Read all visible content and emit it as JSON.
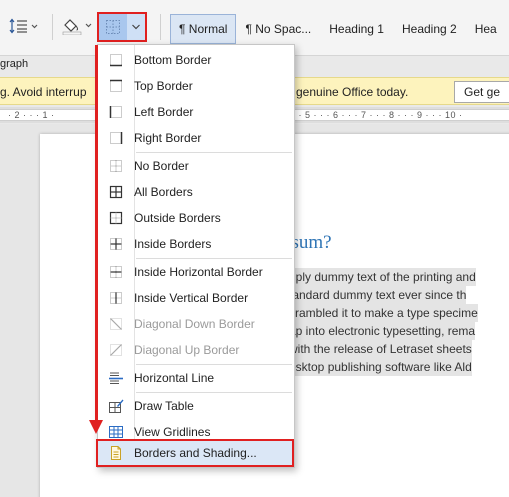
{
  "ribbon": {
    "styles": [
      {
        "label": "¶ Normal",
        "active": true
      },
      {
        "label": "¶ No Spac...",
        "active": false
      },
      {
        "label": "Heading 1",
        "active": false
      },
      {
        "label": "Heading 2",
        "active": false
      },
      {
        "label": "Hea",
        "active": false
      }
    ],
    "group_label": "graph"
  },
  "notification": {
    "left_text": "g. Avoid interrup",
    "right_text": "genuine Office today.",
    "button_label": "Get ge"
  },
  "ruler": {
    "left_marks": "· 2 · · · 1 ·",
    "right_marks": "· · 5 · · · 6 · · · 7 · · · 8 · · · 9 · · · 10 ·"
  },
  "document": {
    "heading": "psum?",
    "lines": [
      "nply dummy text of the printing and",
      "tandard dummy text ever since th",
      "crambled it to make a type specime",
      "ap into electronic typesetting, rema",
      "with the release of Letraset sheets",
      "esktop publishing software like Ald"
    ]
  },
  "borders_menu": {
    "items": [
      {
        "label": "Bottom Border",
        "icon": "bottom-border-icon",
        "disabled": false
      },
      {
        "label": "Top Border",
        "icon": "top-border-icon",
        "disabled": false
      },
      {
        "label": "Left Border",
        "icon": "left-border-icon",
        "disabled": false
      },
      {
        "label": "Right Border",
        "icon": "right-border-icon",
        "disabled": false
      },
      {
        "label": "No Border",
        "icon": "no-border-icon",
        "disabled": false
      },
      {
        "label": "All Borders",
        "icon": "all-borders-icon",
        "disabled": false
      },
      {
        "label": "Outside Borders",
        "icon": "outside-borders-icon",
        "disabled": false
      },
      {
        "label": "Inside Borders",
        "icon": "inside-borders-icon",
        "disabled": false
      },
      {
        "label": "Inside Horizontal Border",
        "icon": "inside-horizontal-border-icon",
        "disabled": false
      },
      {
        "label": "Inside Vertical Border",
        "icon": "inside-vertical-border-icon",
        "disabled": false
      },
      {
        "label": "Diagonal Down Border",
        "icon": "diagonal-down-border-icon",
        "disabled": true
      },
      {
        "label": "Diagonal Up Border",
        "icon": "diagonal-up-border-icon",
        "disabled": true
      },
      {
        "label": "Horizontal Line",
        "icon": "horizontal-line-icon",
        "disabled": false
      },
      {
        "label": "Draw Table",
        "icon": "draw-table-icon",
        "disabled": false
      },
      {
        "label": "View Gridlines",
        "icon": "view-gridlines-icon",
        "disabled": false
      },
      {
        "label": "Borders and Shading...",
        "icon": "borders-and-shading-icon",
        "disabled": false
      }
    ]
  },
  "colors": {
    "annotation_red": "#e02020",
    "heading_blue": "#2e74b5",
    "notify_yellow": "#fdf3bd",
    "selected_blue": "#cfe0f6"
  }
}
